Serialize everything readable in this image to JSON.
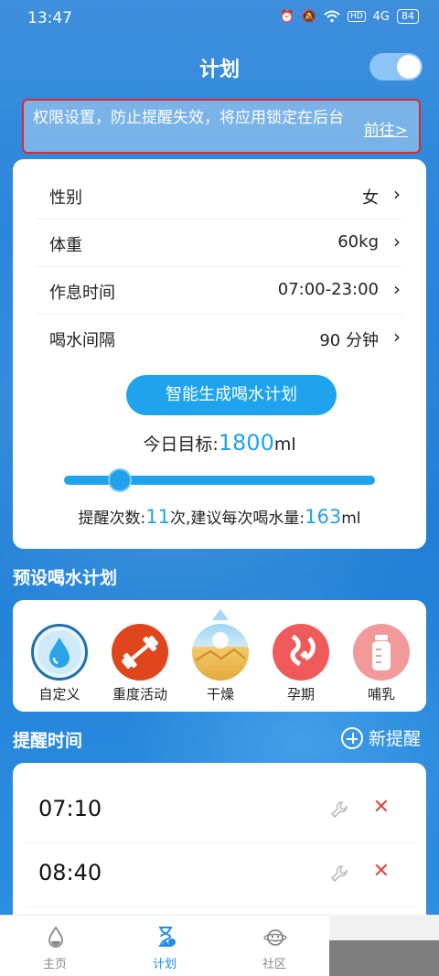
{
  "status_bar": {
    "time": "13:47",
    "network": "4G",
    "battery": "84"
  },
  "header": {
    "title": "计划",
    "toggle_on": true
  },
  "banner": {
    "message": "权限设置，防止提醒失效，将应用锁定在后台",
    "action": "前往>"
  },
  "settings": {
    "rows": [
      {
        "label": "性别",
        "value": "女"
      },
      {
        "label": "体重",
        "value": "60kg"
      },
      {
        "label": "作息时间",
        "value": "07:00-23:00"
      },
      {
        "label": "喝水间隔",
        "value": "90 分钟"
      }
    ],
    "chevron": "›",
    "generate_button": "智能生成喝水计划",
    "target_label": "今日目标:",
    "target_value": "1800",
    "target_unit": "ml",
    "slider_fraction": 0.18,
    "advice_prefix": "提醒次数:",
    "advice_count": "11",
    "advice_mid": "次,建议每次喝水量:",
    "advice_amount": "163",
    "advice_unit": "ml"
  },
  "presets_section": {
    "title": "预设喝水计划",
    "items": [
      {
        "name": "自定义",
        "icon": "water-drop-icon",
        "selected": true
      },
      {
        "name": "重度活动",
        "icon": "dumbbell-icon"
      },
      {
        "name": "干燥",
        "icon": "desert-icon"
      },
      {
        "name": "孕期",
        "icon": "pregnancy-icon"
      },
      {
        "name": "哺乳",
        "icon": "baby-bottle-icon"
      }
    ]
  },
  "reminders_section": {
    "title": "提醒时间",
    "new_label": "新提醒",
    "items": [
      {
        "time": "07:10"
      },
      {
        "time": "08:40"
      }
    ],
    "delete_glyph": "✕"
  },
  "tabbar": {
    "tabs": [
      {
        "label": "主页",
        "icon": "drop-home-icon"
      },
      {
        "label": "计划",
        "icon": "hourglass-icon",
        "active": true
      },
      {
        "label": "社区",
        "icon": "planet-icon"
      }
    ]
  },
  "colors": {
    "accent": "#1ea3ec",
    "delete": "#e04848",
    "banner_border": "#e02828"
  }
}
